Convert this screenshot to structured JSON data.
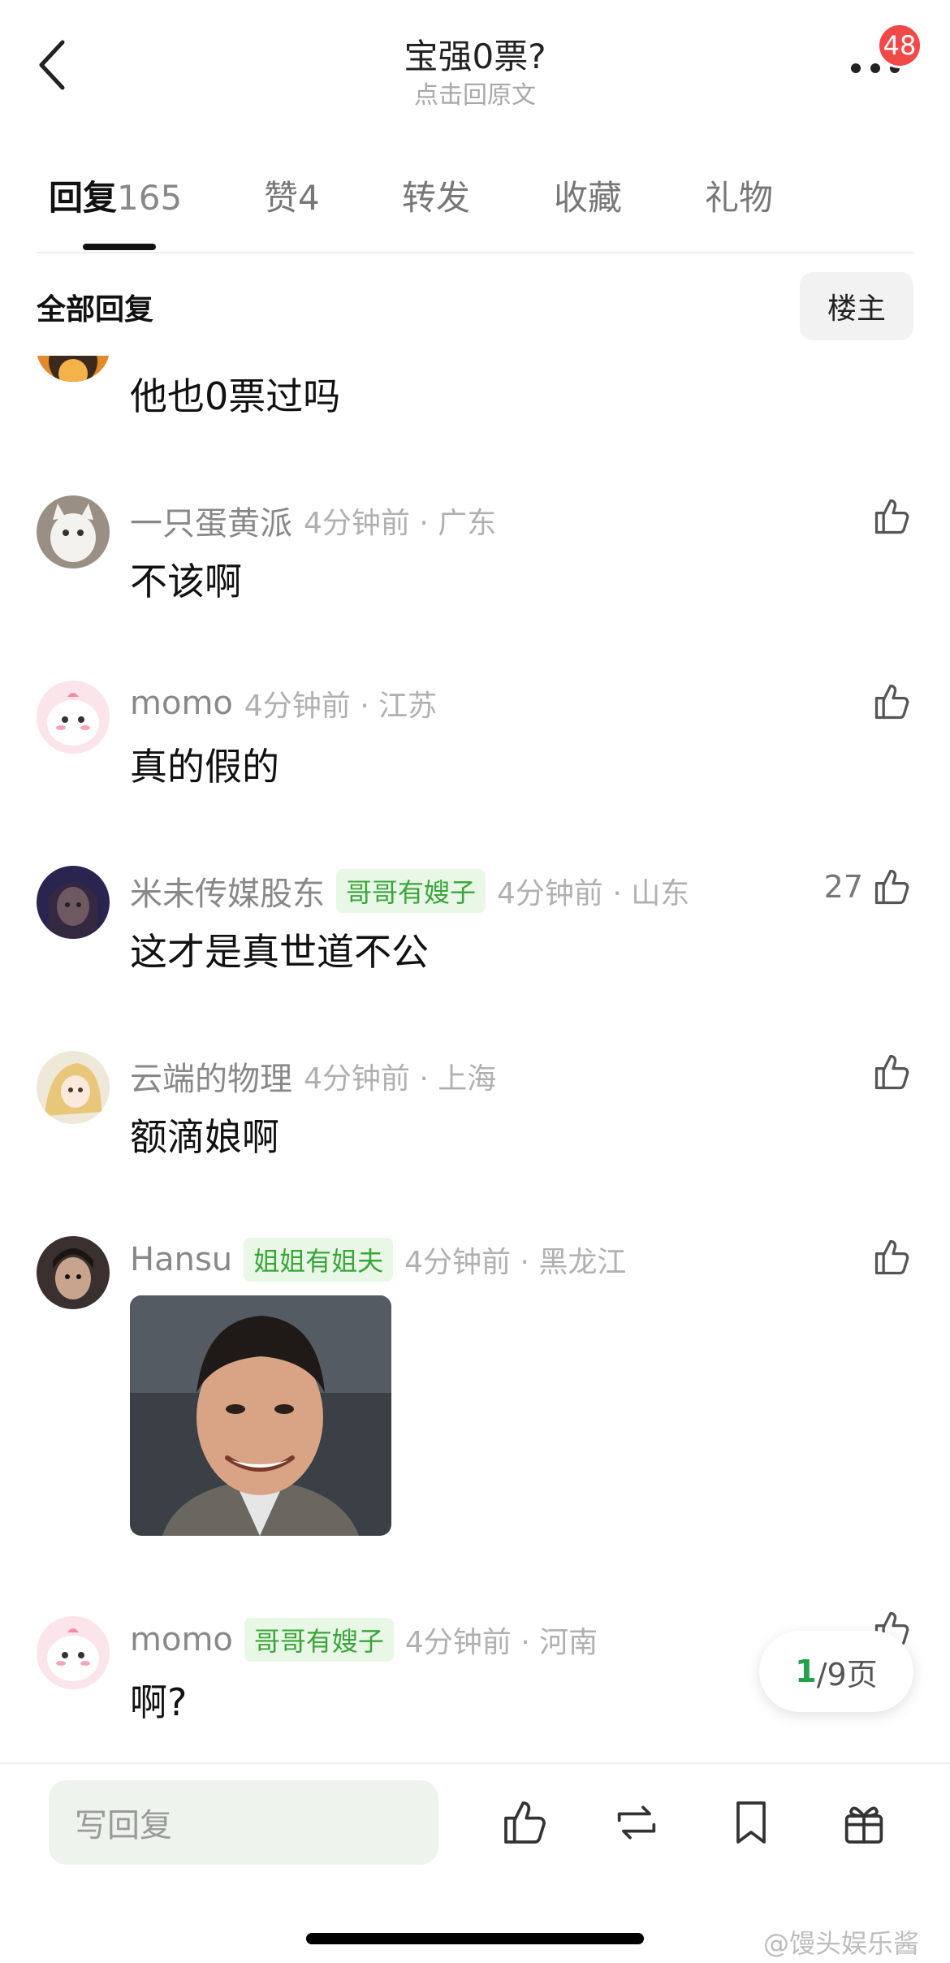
{
  "header": {
    "title": "宝强0票?",
    "subtitle": "点击回原文",
    "badge_count": "48"
  },
  "tabs": [
    {
      "label": "回复",
      "count": "165"
    },
    {
      "label": "赞",
      "count": "4"
    },
    {
      "label": "转发",
      "count": ""
    },
    {
      "label": "收藏",
      "count": ""
    },
    {
      "label": "礼物",
      "count": ""
    }
  ],
  "section": {
    "title": "全部回复",
    "filter_label": "楼主"
  },
  "comments": [
    {
      "name": "",
      "tag": "",
      "time": "",
      "text": "他也0票过吗",
      "likes": ""
    },
    {
      "name": "一只蛋黄派",
      "tag": "",
      "time": "4分钟前 · 广东",
      "text": "不该啊",
      "likes": ""
    },
    {
      "name": "momo",
      "tag": "",
      "time": "4分钟前 · 江苏",
      "text": "真的假的",
      "likes": ""
    },
    {
      "name": "米未传媒股东",
      "tag": "哥哥有嫂子",
      "time": "4分钟前 · 山东",
      "text": "这才是真世道不公",
      "likes": "27"
    },
    {
      "name": "云端的物理",
      "tag": "",
      "time": "4分钟前 · 上海",
      "text": "额滴娘啊",
      "likes": ""
    },
    {
      "name": "Hansu",
      "tag": "姐姐有姐夫",
      "time": "4分钟前 · 黑龙江",
      "text": "",
      "likes": ""
    },
    {
      "name": "momo",
      "tag": "哥哥有嫂子",
      "time": "4分钟前 · 河南",
      "text": "啊?",
      "likes": ""
    }
  ],
  "pagination": {
    "current": "1",
    "total_text": "/9页"
  },
  "composer": {
    "placeholder": "写回复"
  },
  "watermark": "@馒头娱乐酱",
  "colors": {
    "accent_green": "#26a04a",
    "tag_green": "#3aa63a",
    "badge_red": "#f24848"
  },
  "icons": [
    "back-icon",
    "more-icon",
    "thumbs-up-icon",
    "repost-icon",
    "bookmark-icon",
    "gift-icon"
  ]
}
